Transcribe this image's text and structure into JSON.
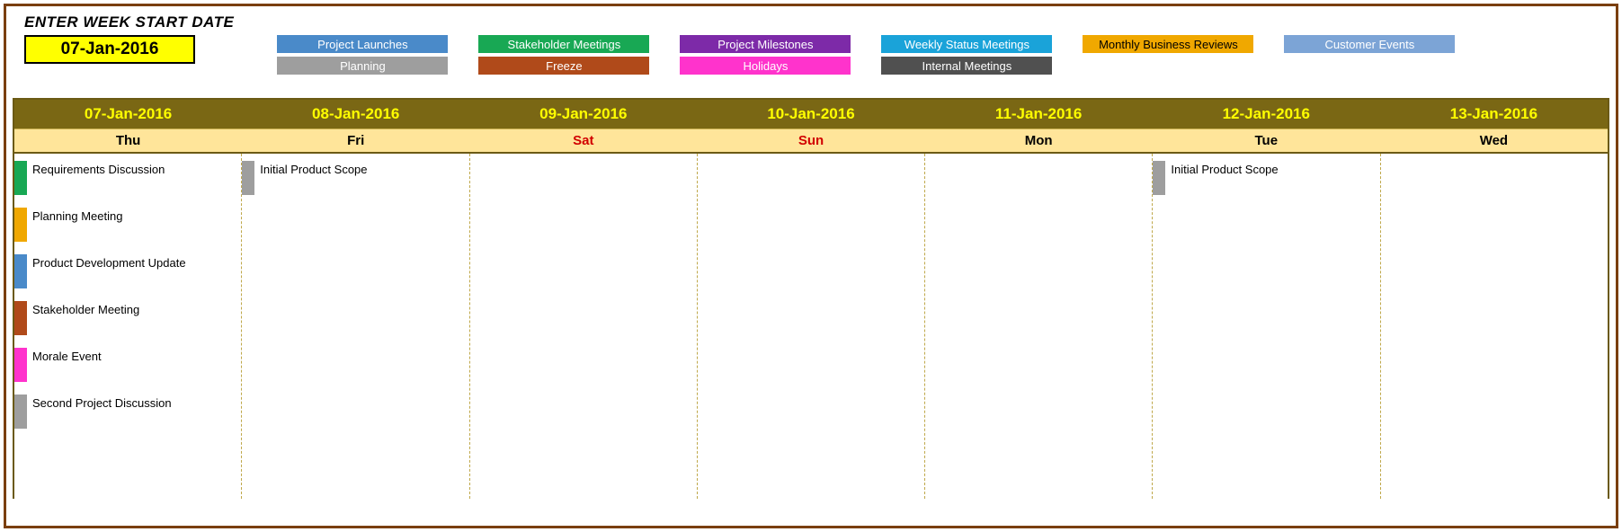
{
  "header": {
    "label": "ENTER WEEK START DATE",
    "value": "07-Jan-2016"
  },
  "legend": {
    "row1": [
      {
        "label": "Project Launches",
        "cls": "c-launches"
      },
      {
        "label": "Stakeholder Meetings",
        "cls": "c-stakeholder"
      },
      {
        "label": "Project Milestones",
        "cls": "c-milestones"
      },
      {
        "label": "Weekly Status Meetings",
        "cls": "c-weekly"
      },
      {
        "label": "Monthly Business Reviews",
        "cls": "c-monthly",
        "textcls": "lbl-monthly"
      },
      {
        "label": "Customer Events",
        "cls": "c-customer"
      }
    ],
    "row2": [
      {
        "label": "Planning",
        "cls": "c-planning"
      },
      {
        "label": "Freeze",
        "cls": "c-freeze"
      },
      {
        "label": "Holidays",
        "cls": "c-holidays"
      },
      {
        "label": "Internal Meetings",
        "cls": "c-internal"
      }
    ]
  },
  "days": [
    {
      "date": "07-Jan-2016",
      "dow": "Thu",
      "weekend": false
    },
    {
      "date": "08-Jan-2016",
      "dow": "Fri",
      "weekend": false
    },
    {
      "date": "09-Jan-2016",
      "dow": "Sat",
      "weekend": true
    },
    {
      "date": "10-Jan-2016",
      "dow": "Sun",
      "weekend": true
    },
    {
      "date": "11-Jan-2016",
      "dow": "Mon",
      "weekend": false
    },
    {
      "date": "12-Jan-2016",
      "dow": "Tue",
      "weekend": false
    },
    {
      "date": "13-Jan-2016",
      "dow": "Wed",
      "weekend": false
    }
  ],
  "events": {
    "0": [
      {
        "label": "Requirements Discussion",
        "cls": "c-stakeholder"
      },
      {
        "label": "Planning Meeting",
        "cls": "c-monthly"
      },
      {
        "label": "Product Development Update",
        "cls": "c-launches"
      },
      {
        "label": "Stakeholder Meeting",
        "cls": "c-freeze"
      },
      {
        "label": "Morale Event",
        "cls": "c-holidays"
      },
      {
        "label": "Second Project Discussion",
        "cls": "c-planning"
      }
    ],
    "1": [
      {
        "label": "Initial Product Scope",
        "cls": "c-planning"
      }
    ],
    "2": [],
    "3": [],
    "4": [],
    "5": [
      {
        "label": "Initial Product Scope",
        "cls": "c-planning"
      }
    ],
    "6": []
  }
}
